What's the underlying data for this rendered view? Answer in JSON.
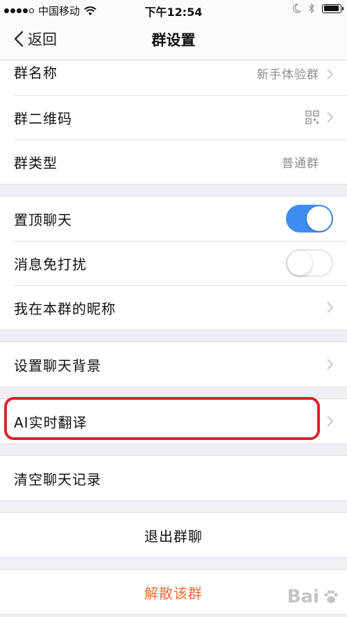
{
  "status_bar": {
    "carrier": "中国移动",
    "time": "下午12:54"
  },
  "nav": {
    "back_label": "返回",
    "title": "群设置"
  },
  "group_info": {
    "name_label": "群名称",
    "name_value": "新手体验群",
    "qrcode_label": "群二维码",
    "type_label": "群类型",
    "type_value": "普通群"
  },
  "chat_settings": {
    "pin_label": "置顶聊天",
    "pin_on": true,
    "mute_label": "消息免打扰",
    "mute_on": false,
    "nickname_label": "我在本群的昵称"
  },
  "background": {
    "label": "设置聊天背景"
  },
  "translate": {
    "label": "AI实时翻译"
  },
  "clear": {
    "label": "清空聊天记录"
  },
  "actions": {
    "exit_label": "退出群聊",
    "dismiss_label": "解散该群"
  },
  "watermark": {
    "text": "Bai"
  },
  "colors": {
    "toggle_on": "#3d8ef0",
    "danger": "#ef6a3a",
    "highlight": "#d9242b"
  }
}
